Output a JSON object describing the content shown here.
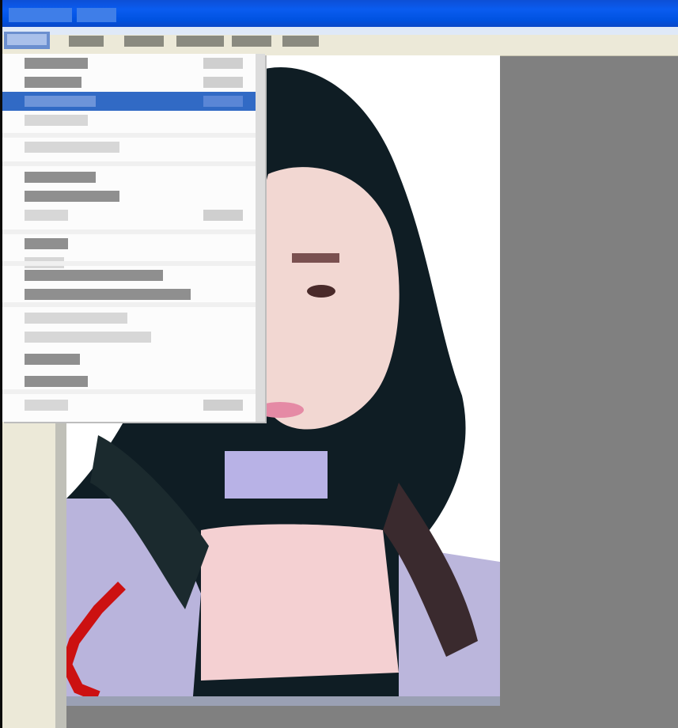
{
  "window": {
    "title": "",
    "accent": "#0a5cf0"
  },
  "menubar": {
    "items": [
      {
        "label": "",
        "active": true
      },
      {
        "label": ""
      },
      {
        "label": ""
      },
      {
        "label": ""
      },
      {
        "label": ""
      },
      {
        "label": ""
      }
    ]
  },
  "menu": {
    "open": true,
    "selected_index": 2,
    "items": [
      {
        "label": "",
        "has_shortcut": true
      },
      {
        "label": "",
        "has_shortcut": true
      },
      {
        "label": "",
        "selected": true,
        "has_shortcut": true
      },
      {
        "label": "",
        "disabled": true
      },
      {
        "separator": true
      },
      {
        "label": "",
        "disabled": true
      },
      {
        "separator": true
      },
      {
        "label": ""
      },
      {
        "label": ""
      },
      {
        "label": "",
        "disabled": true,
        "has_shortcut": true
      },
      {
        "separator": true
      },
      {
        "label": ""
      },
      {
        "label": "",
        "disabled": true
      },
      {
        "separator": true
      },
      {
        "label": ""
      },
      {
        "label": ""
      },
      {
        "separator": true
      },
      {
        "label": "",
        "disabled": true
      },
      {
        "label": "",
        "disabled": true
      },
      {
        "label": ""
      },
      {
        "label": ""
      },
      {
        "separator": true
      },
      {
        "label": "",
        "disabled": true,
        "has_shortcut": true
      }
    ]
  },
  "canvas": {
    "image_description_icon": "portrait-photo-icon",
    "zoom_level": ""
  },
  "colors": {
    "menu_highlight": "#316ac5",
    "workspace": "#808080",
    "panel": "#ece9d8"
  }
}
